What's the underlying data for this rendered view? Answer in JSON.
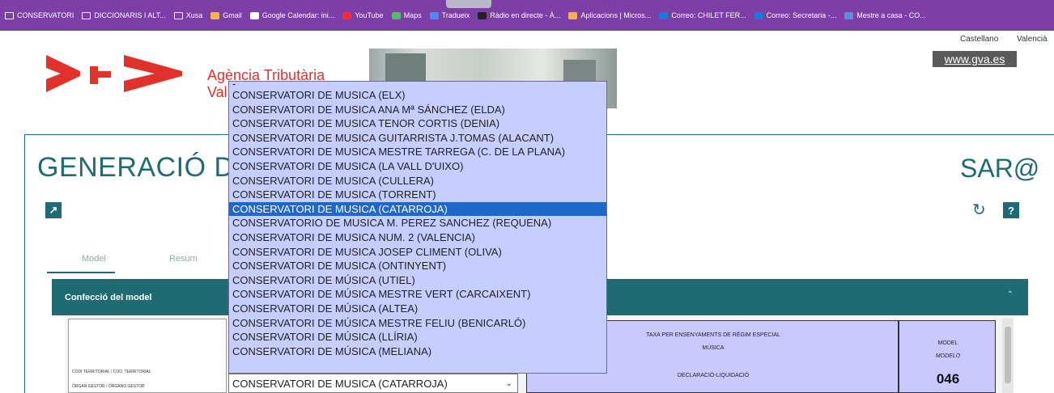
{
  "bookmarks": [
    {
      "label": "CONSERVATORI",
      "icon": "folder-icon"
    },
    {
      "label": "DICCIONARIS I ALT...",
      "icon": "folder-icon"
    },
    {
      "label": "Xusa",
      "icon": "folder-icon"
    },
    {
      "label": "Gmail",
      "icon": "gmail-icon"
    },
    {
      "label": "Google Calendar: ini...",
      "icon": "google-icon"
    },
    {
      "label": "YouTube",
      "icon": "youtube-icon"
    },
    {
      "label": "Maps",
      "icon": "maps-icon"
    },
    {
      "label": "Tradueix",
      "icon": "translate-icon"
    },
    {
      "label": "Ràdio en directe - À...",
      "icon": "radio-icon"
    },
    {
      "label": "Aplicacions | Micros...",
      "icon": "microsoft-icon"
    },
    {
      "label": "Correo: CHILET FER...",
      "icon": "outlook-icon"
    },
    {
      "label": "Correo: Secretaria -...",
      "icon": "outlook-icon"
    },
    {
      "label": "Mestre a casa - CO...",
      "icon": "app-icon"
    }
  ],
  "header": {
    "lang_es": "Castellano",
    "lang_va": "Valencià",
    "gva_link": "www.gva.es",
    "agency_line1": "Agència Tributària",
    "agency_line2": "Val"
  },
  "main": {
    "title": "GENERACIÓ D",
    "brand": "SAR@",
    "tabs": [
      "Model",
      "Resum"
    ],
    "section_title": "Confecció del model"
  },
  "form": {
    "left_label1": "CODI TERRITORIAL / COD. TERRITORIAL",
    "left_label2": "ÒRGAN GESTOR / ÓRGANO GESTOR",
    "tax_line1": "TAXA PER ENSENYAMENTS DE RÈGIM ESPECIAL",
    "tax_line2": "MÚSICA",
    "tax_line3": "DECLARACIÓ-LIQUIDACIÓ",
    "model_label": "MODEL",
    "modelo_label": "MODELO",
    "model_number": "046"
  },
  "select": {
    "value": "CONSERVATORI DE MUSICA (CATARROJA)",
    "options": [
      "-",
      "CONSERVATORI DE MUSICA (ELX)",
      "CONSERVATORI DE MUSICA ANA Mª SÁNCHEZ (ELDA)",
      "CONSERVATORI DE MUSICA TENOR CORTIS (DENIA)",
      "CONSERVATORI DE MUSICA GUITARRISTA J.TOMAS (ALACANT)",
      "CONSERVATORI DE MUSICA MESTRE TARREGA (C. DE LA PLANA)",
      "CONSERVATORI DE MUSICA (LA VALL D'UIXO)",
      "CONSERVATORI DE MUSICA (CULLERA)",
      "CONSERVATORI DE MUSICA (TORRENT)",
      "CONSERVATORI DE MUSICA (CATARROJA)",
      "CONSERVATORIO DE MUSICA M. PEREZ SANCHEZ (REQUENA)",
      "CONSERVATORI DE MUSICA NUM. 2 (VALENCIA)",
      "CONSERVATORI DE MUSICA JOSEP CLIMENT (OLIVA)",
      "CONSERVATORI DE MUSICA (ONTINYENT)",
      "CONSERVATORI DE MÚSICA (UTIEL)",
      "CONSERVATORI DE MÚSICA MESTRE VERT (CARCAIXENT)",
      "CONSERVATORI DE MÚSICA (ALTEA)",
      "CONSERVATORI DE MÚSICA MESTRE FELIU (BENICARLÓ)",
      "CONSERVATORI DE MÚSICA (LLÍRIA)",
      "CONSERVATORI DE MÚSICA (MELIANA)"
    ],
    "selected_index": 9
  },
  "colors": {
    "bookmark_bar": "#7b3fa6",
    "brand_teal": "#1f6b73",
    "logo_red": "#e0312b",
    "dropdown_bg": "#c6ceff",
    "highlight": "#1f67c9"
  }
}
